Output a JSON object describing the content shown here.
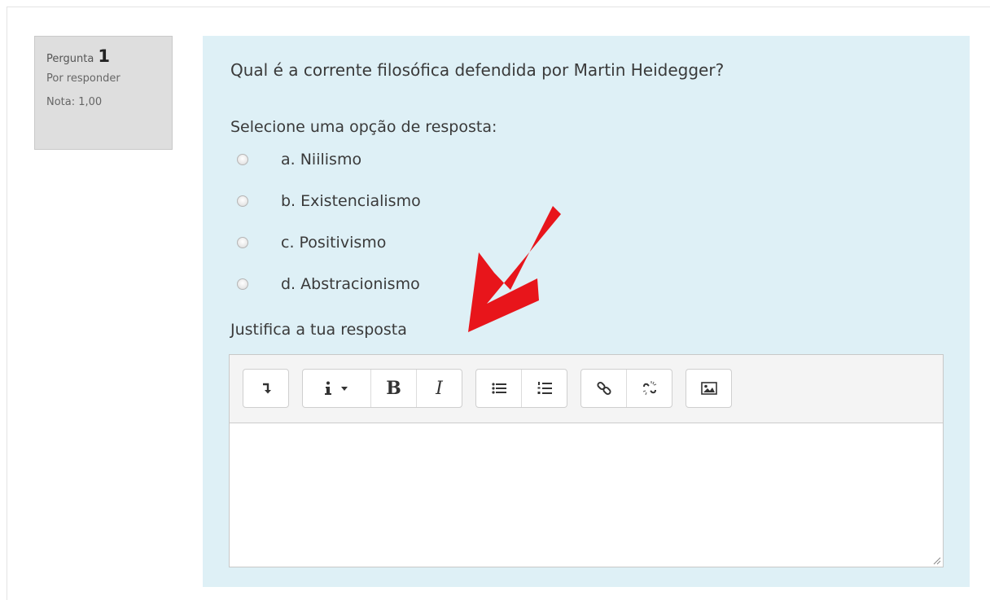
{
  "question_info": {
    "label": "Pergunta",
    "number": "1",
    "status": "Por responder",
    "grade": "Nota: 1,00"
  },
  "question": {
    "text": "Qual é a corrente filosófica defendida por Martin Heidegger?",
    "prompt": "Selecione uma opção de resposta:",
    "options": [
      {
        "label": "a. Niilismo",
        "selected": false
      },
      {
        "label": "b. Existencialismo",
        "selected": false
      },
      {
        "label": "c. Positivismo",
        "selected": false
      },
      {
        "label": "d. Abstracionismo",
        "selected": false
      }
    ],
    "justify_label": "Justifica a tua resposta"
  },
  "editor": {
    "toolbar_icons": [
      "collapse-toolbar-icon",
      "paragraph-style-icon",
      "bold-icon",
      "italic-icon",
      "unordered-list-icon",
      "ordered-list-icon",
      "link-icon",
      "unlink-icon",
      "image-icon"
    ],
    "bold_glyph": "B",
    "italic_glyph": "I",
    "content": ""
  },
  "colors": {
    "content_background": "#def0f6",
    "info_background": "#dedede",
    "arrow": "#e8151b"
  }
}
